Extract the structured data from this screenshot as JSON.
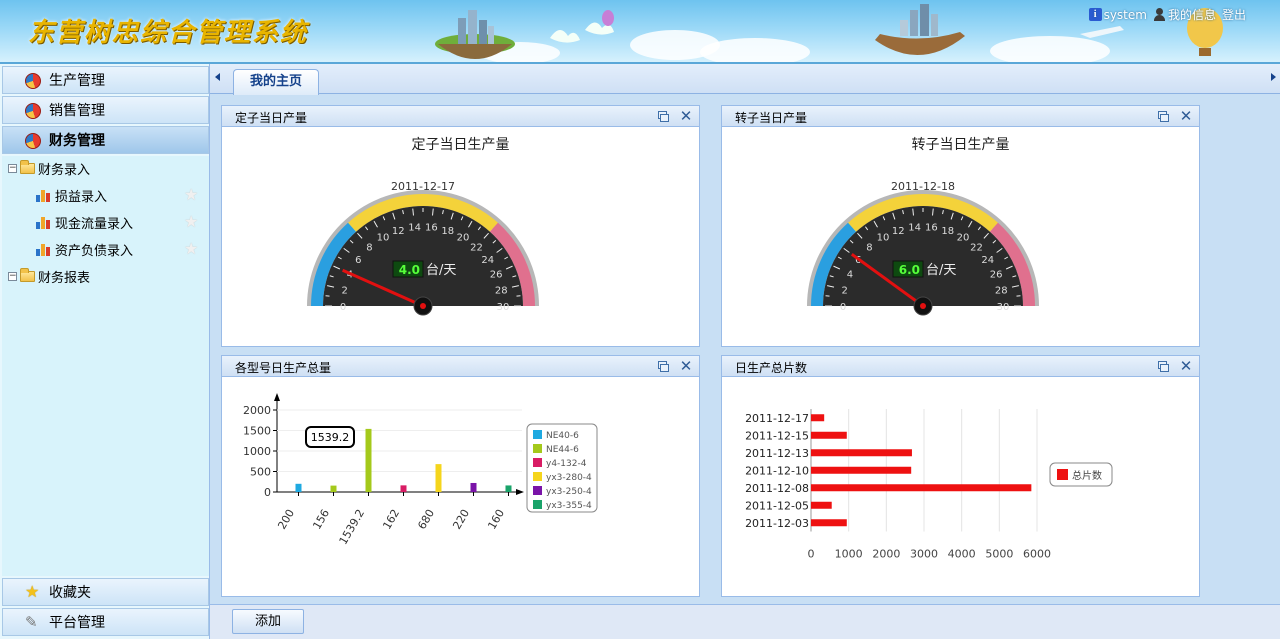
{
  "app": {
    "title": "东营树忠综合管理系统",
    "user_name": "system",
    "my_info_label": "我的信息",
    "logout_label": "登出"
  },
  "sidebar": {
    "sections": [
      {
        "label": "生产管理"
      },
      {
        "label": "销售管理"
      },
      {
        "label": "财务管理"
      }
    ],
    "tree": [
      {
        "label": "财务录入",
        "toggle": "⊟"
      },
      {
        "label": "损益录入"
      },
      {
        "label": "现金流量录入"
      },
      {
        "label": "资产负债录入"
      },
      {
        "label": "财务报表",
        "toggle": "⊟"
      }
    ],
    "bottom": [
      {
        "label": "收藏夹"
      },
      {
        "label": "平台管理"
      }
    ]
  },
  "tabs": [
    {
      "label": "我的主页"
    }
  ],
  "portlets": [
    {
      "title": "定子当日产量"
    },
    {
      "title": "转子当日产量"
    },
    {
      "title": "各型号日生产总量"
    },
    {
      "title": "日生产总片数"
    }
  ],
  "gauges": [
    {
      "chart_title": "定子当日生产量",
      "date": "2011-12-17",
      "value": 4.0,
      "value_label": "4.0",
      "unit": "台/天",
      "min": 0,
      "max": 30,
      "ticks": [
        "0",
        "2",
        "4",
        "6",
        "8",
        "10",
        "12",
        "14",
        "16",
        "18",
        "20",
        "22",
        "24",
        "26",
        "28",
        "30"
      ]
    },
    {
      "chart_title": "转子当日生产量",
      "date": "2011-12-18",
      "value": 6.0,
      "value_label": "6.0",
      "unit": "台/天",
      "min": 0,
      "max": 30,
      "ticks": [
        "0",
        "2",
        "4",
        "6",
        "8",
        "10",
        "12",
        "14",
        "16",
        "18",
        "20",
        "22",
        "24",
        "26",
        "28",
        "30"
      ]
    }
  ],
  "gauge_colors": {
    "low": "#2a9fe0",
    "mid": "#f4d23a",
    "high": "#e0708e"
  },
  "chart_data": [
    {
      "type": "bar",
      "categories": [
        "200",
        "156",
        "1539.2",
        "162",
        "680",
        "220",
        "160"
      ],
      "series": [
        {
          "name": "NE40-6",
          "color": "#1ea9e1",
          "values": [
            200,
            0,
            0,
            0,
            0,
            0,
            0
          ]
        },
        {
          "name": "NE44-6",
          "color": "#a4c91b",
          "values": [
            0,
            156,
            1539.2,
            0,
            0,
            0,
            0
          ]
        },
        {
          "name": "y4-132-4",
          "color": "#d81c64",
          "values": [
            0,
            0,
            0,
            162,
            0,
            0,
            0
          ]
        },
        {
          "name": "yx3-280-4",
          "color": "#f5d51c",
          "values": [
            0,
            0,
            0,
            0,
            680,
            0,
            0
          ]
        },
        {
          "name": "yx3-250-4",
          "color": "#7a13a8",
          "values": [
            0,
            0,
            0,
            0,
            0,
            220,
            0
          ]
        },
        {
          "name": "yx3-355-4",
          "color": "#1aa36a",
          "values": [
            0,
            0,
            0,
            0,
            0,
            0,
            160
          ]
        }
      ],
      "yticks": [
        "0",
        "500",
        "1000",
        "1500",
        "2000"
      ],
      "ylim": [
        0,
        2000
      ],
      "tooltip": "1539.2",
      "legend": "right"
    },
    {
      "type": "bar",
      "orientation": "horizontal",
      "categories": [
        "2011-12-17",
        "2011-12-15",
        "2011-12-13",
        "2011-12-10",
        "2011-12-08",
        "2011-12-05",
        "2011-12-03"
      ],
      "series": [
        {
          "name": "总片数",
          "color": "#ee1111",
          "values": [
            350,
            950,
            2680,
            2660,
            5850,
            550,
            950
          ]
        }
      ],
      "xticks": [
        "0",
        "1000",
        "2000",
        "3000",
        "4000",
        "5000",
        "6000"
      ],
      "xlim": [
        0,
        6000
      ],
      "legend": "right"
    }
  ],
  "buttons": {
    "add_label": "添加"
  }
}
